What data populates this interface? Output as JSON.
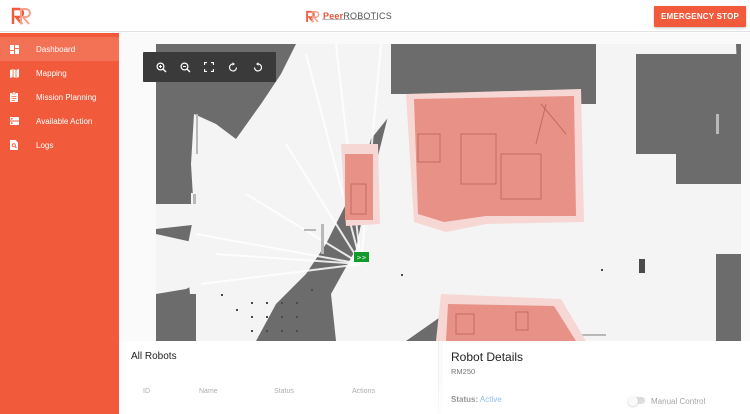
{
  "header": {
    "brand_peer": "Peer",
    "brand_rest": "ROBOTICS",
    "emergency_stop_label": "EMERGENCY STOP"
  },
  "sidebar": {
    "items": [
      {
        "label": "Dashboard",
        "icon": "dashboard-icon",
        "active": true
      },
      {
        "label": "Mapping",
        "icon": "map-icon",
        "active": false
      },
      {
        "label": "Mission Planning",
        "icon": "clipboard-icon",
        "active": false
      },
      {
        "label": "Available Action",
        "icon": "list-icon",
        "active": false
      },
      {
        "label": "Logs",
        "icon": "search-document-icon",
        "active": false
      }
    ]
  },
  "map_toolbar": {
    "tools": [
      "zoom-in-icon",
      "zoom-out-icon",
      "fit-screen-icon",
      "rotate-right-icon",
      "rotate-left-icon"
    ]
  },
  "map": {
    "robot_marker_label": ">>"
  },
  "all_robots": {
    "title": "All Robots",
    "columns": [
      "ID",
      "Name",
      "Status",
      "Actions"
    ]
  },
  "robot_details": {
    "title": "Robot Details",
    "model": "RM250",
    "status_label": "Status:",
    "status_value": "Active",
    "manual_control_label": "Manual Control"
  },
  "colors": {
    "accent": "#f15a3a",
    "zone_fill": "#e89187",
    "status_active": "#2f7fd1"
  }
}
